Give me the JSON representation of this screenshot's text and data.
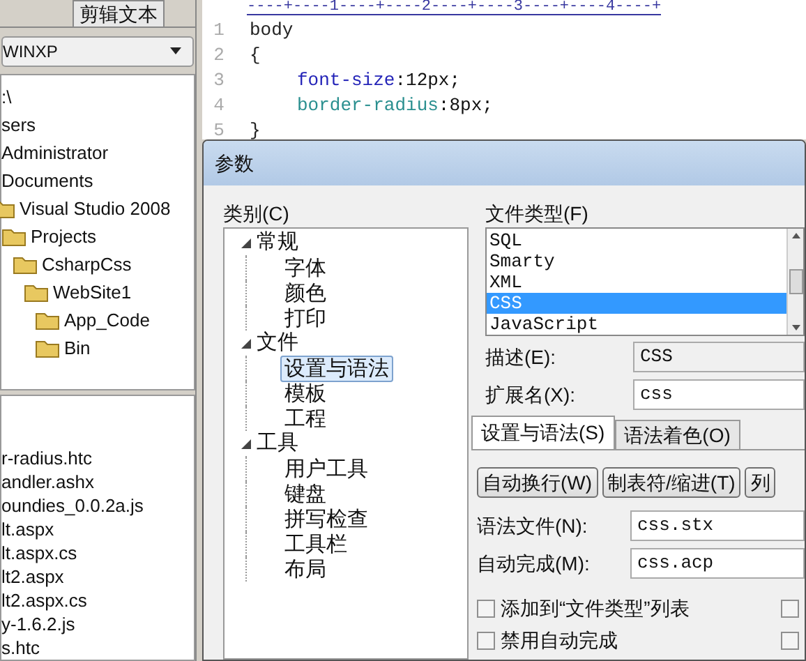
{
  "left_panel": {
    "tab": "剪辑文本",
    "drive": "WINXP",
    "folders": [
      {
        "label": ":\\",
        "kind": "text"
      },
      {
        "label": "sers",
        "kind": "text"
      },
      {
        "label": "Administrator",
        "kind": "text"
      },
      {
        "label": "Documents",
        "kind": "text"
      },
      {
        "label": "Visual Studio 2008",
        "kind": "folder"
      },
      {
        "label": "Projects",
        "kind": "folder"
      },
      {
        "label": "CsharpCss",
        "kind": "folder"
      },
      {
        "label": "WebSite1",
        "kind": "folder"
      },
      {
        "label": "App_Code",
        "kind": "folder"
      },
      {
        "label": "Bin",
        "kind": "folder"
      }
    ],
    "files": [
      "r-radius.htc",
      "andler.ashx",
      "oundies_0.0.2a.js",
      "lt.aspx",
      "lt.aspx.cs",
      "lt2.aspx",
      "lt2.aspx.cs",
      "y-1.6.2.js",
      "s.htc"
    ]
  },
  "editor": {
    "ruler": "----+----1----+----2----+----3----+----4----+",
    "lines": [
      {
        "number": "1",
        "kind": "plain",
        "text": "body"
      },
      {
        "number": "2",
        "kind": "plain",
        "text": "{"
      },
      {
        "number": "3",
        "kind": "property",
        "prop": "font-size",
        "value": ":12px;"
      },
      {
        "number": "4",
        "kind": "property2",
        "prop": "border-radius",
        "value": ":8px;"
      },
      {
        "number": "5",
        "kind": "plain",
        "text": "}"
      }
    ]
  },
  "dialog": {
    "title": "参数",
    "category_label": "类别(C)",
    "categories": [
      {
        "label": "常规",
        "expanded": true,
        "children": [
          {
            "label": "字体",
            "selected": false
          },
          {
            "label": "颜色",
            "selected": false
          },
          {
            "label": "打印",
            "selected": false
          }
        ]
      },
      {
        "label": "文件",
        "expanded": true,
        "children": [
          {
            "label": "设置与语法",
            "selected": true
          },
          {
            "label": "模板",
            "selected": false
          },
          {
            "label": "工程",
            "selected": false
          }
        ]
      },
      {
        "label": "工具",
        "expanded": true,
        "children": [
          {
            "label": "用户工具",
            "selected": false
          },
          {
            "label": "键盘",
            "selected": false
          },
          {
            "label": "拼写检查",
            "selected": false
          },
          {
            "label": "工具栏",
            "selected": false
          },
          {
            "label": "布局",
            "selected": false
          }
        ]
      }
    ],
    "file_type_label": "文件类型(F)",
    "file_types": [
      {
        "label": "SQL",
        "selected": false
      },
      {
        "label": "Smarty",
        "selected": false
      },
      {
        "label": "XML",
        "selected": false
      },
      {
        "label": "CSS",
        "selected": true
      },
      {
        "label": "JavaScript",
        "selected": false
      }
    ],
    "description": {
      "label": "描述(E):",
      "value": "CSS"
    },
    "extension": {
      "label": "扩展名(X):",
      "value": "css"
    },
    "tabs": [
      {
        "label": "设置与语法(S)",
        "selected": true
      },
      {
        "label": "语法着色(O)",
        "selected": false
      }
    ],
    "buttons": [
      "自动换行(W)",
      "制表符/缩进(T)",
      "列"
    ],
    "syntax_file": {
      "label": "语法文件(N):",
      "value": "css.stx"
    },
    "autocomplete": {
      "label": "自动完成(M):",
      "value": "css.acp"
    },
    "checkboxes": [
      {
        "label": "添加到“文件类型”列表",
        "checked": false
      },
      {
        "label": "禁用自动完成",
        "checked": false
      }
    ],
    "checkboxes_right": [
      {
        "checked": false
      },
      {
        "checked": false
      }
    ]
  }
}
